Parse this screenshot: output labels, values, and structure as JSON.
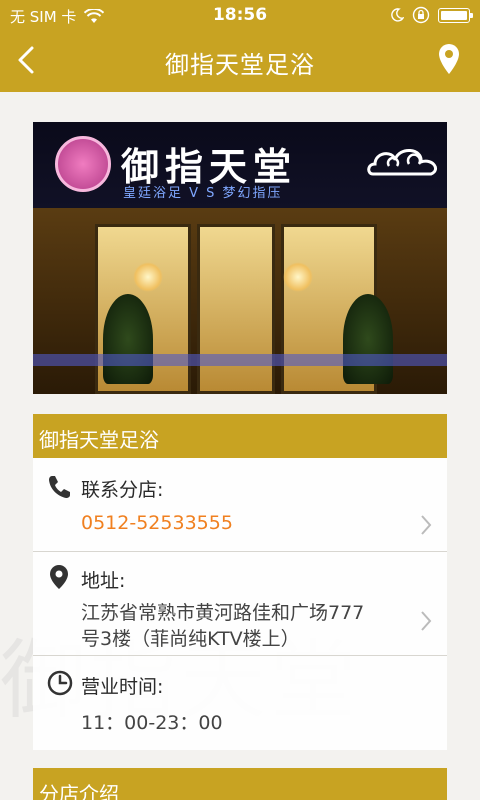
{
  "status_bar": {
    "carrier": "无 SIM 卡",
    "time": "18:56"
  },
  "nav": {
    "title": "御指天堂足浴"
  },
  "photo": {
    "sign_title": "御指天堂",
    "sign_subtitle": "皇廷浴足 V S 梦幻指压"
  },
  "info": {
    "section_title": "御指天堂足浴",
    "contact_label": "联系分店:",
    "phone": "0512-52533555",
    "address_label": "地址:",
    "address_line1": "江苏省常熟市黄河路佳和广场777",
    "address_line2": "号3楼（菲尚纯KTV楼上）",
    "hours_label": "营业时间:",
    "hours": "11：00-23：00"
  },
  "intro": {
    "section_title": "分店介绍"
  },
  "colors": {
    "accent": "#c8a322",
    "phone": "#f08020"
  }
}
